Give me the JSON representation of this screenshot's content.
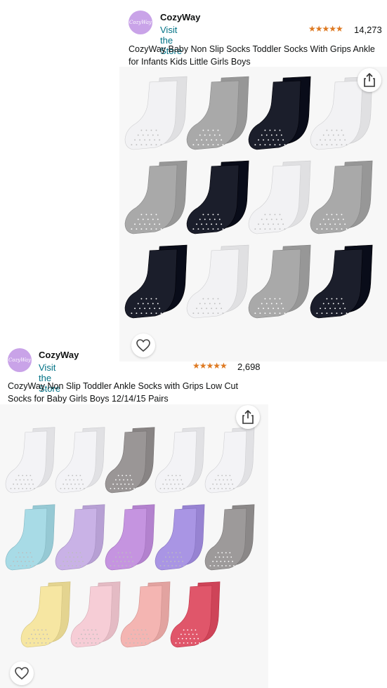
{
  "listings": [
    {
      "brand": "CozyWay",
      "logo_text": "CozyWay",
      "visit_store": "Visit the Store",
      "stars": "★★★★★",
      "rating_count": "14,273",
      "title": "CozyWay Baby Non Slip Socks Toddler Socks With Grips Ankle for Infants Kids Little Girls Boys",
      "sock_colors": [
        "#f2f2f4",
        "#a9a9a9",
        "#1b1e2b",
        "#f2f2f4",
        "#a9a9a9",
        "#1b1e2b",
        "#f2f2f4",
        "#a9a9a9",
        "#1b1e2b",
        "#f2f2f4",
        "#a9a9a9",
        "#1b1e2b"
      ]
    },
    {
      "brand": "CozyWay",
      "logo_text": "CozyWay",
      "visit_store": "Visit the Store",
      "stars": "★★★★★",
      "rating_count": "2,698",
      "title": "CozyWay Non Slip Toddler Ankle Socks with Grips Low Cut Socks for Baby Girls Boys 12/14/15 Pairs",
      "sock_colors": [
        "#f3f3f6",
        "#f3f3f6",
        "#9a9696",
        "#f3f3f6",
        "#f3f3f6",
        "#a8dbe6",
        "#c9b2e6",
        "#c594e0",
        "#a995e4",
        "#9d9a9a",
        "#f6e6a2",
        "#f6cdd6",
        "#f4b5b2",
        "#e0566a"
      ]
    }
  ],
  "colors": {
    "link": "#007185",
    "star": "#de7921",
    "logo_bg": "#c9a3e8"
  }
}
